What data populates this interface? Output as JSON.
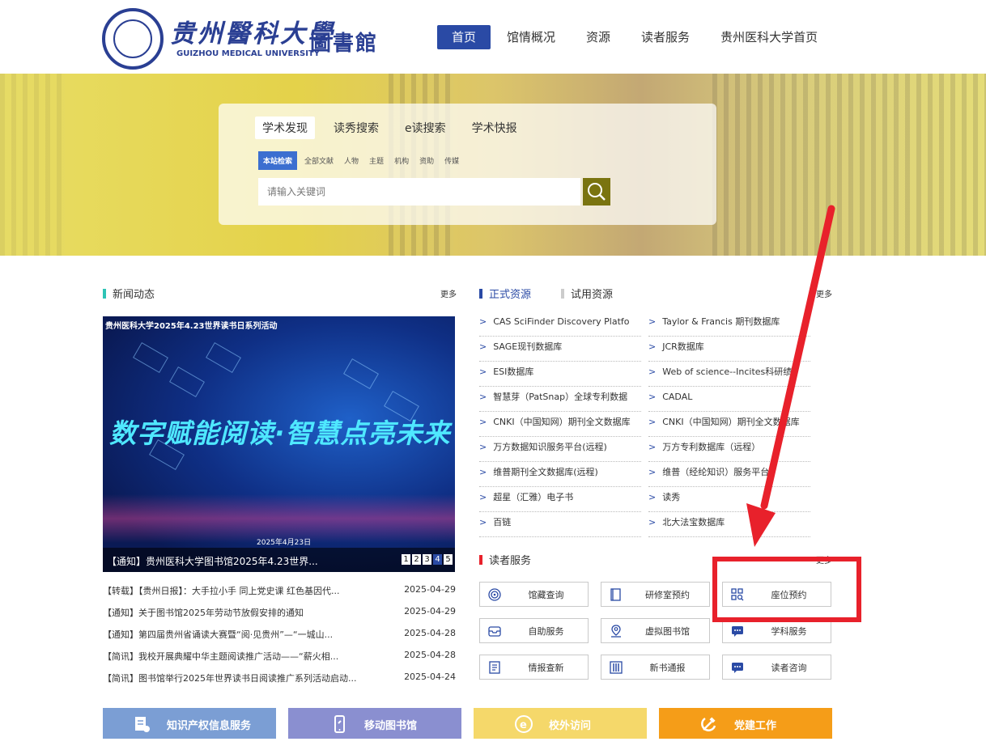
{
  "header": {
    "logo_cn": "贵州醫科大學",
    "logo_en": "GUIZHOU MEDICAL UNIVERSITY",
    "library": "圖書館",
    "nav": [
      "首页",
      "馆情概况",
      "资源",
      "读者服务",
      "贵州医科大学首页"
    ]
  },
  "search": {
    "tabs": [
      "学术发现",
      "读秀搜索",
      "e读搜索",
      "学术快报"
    ],
    "subtabs": [
      "本站检索",
      "全部文献",
      "人物",
      "主题",
      "机构",
      "资助",
      "传媒"
    ],
    "placeholder": "请输入关键词"
  },
  "news": {
    "title": "新闻动态",
    "more": "更多",
    "image_caption_top": "贵州医科大学2025年4.23世界读书日系列活动",
    "image_headline": "数字赋能阅读·智慧点亮未来",
    "image_date": "2025年4月23日",
    "image_caption": "【通知】贵州医科大学图书馆2025年4.23世界...",
    "pager": [
      "1",
      "2",
      "3",
      "4",
      "5"
    ],
    "items": [
      {
        "text": "【转载】【贵州日报】：大手拉小手 同上党史课 红色基因代...",
        "date": "2025-04-29"
      },
      {
        "text": "【通知】关于图书馆2025年劳动节放假安排的通知",
        "date": "2025-04-29"
      },
      {
        "text": "【通知】第四届贵州省诵读大赛暨“阅·见贵州”—“一城山...",
        "date": "2025-04-28"
      },
      {
        "text": "【简讯】我校开展典耀中华主题阅读推广活动——“薪火相...",
        "date": "2025-04-28"
      },
      {
        "text": "【简讯】图书馆举行2025年世界读书日阅读推广系列活动启动...",
        "date": "2025-04-24"
      }
    ]
  },
  "resources": {
    "tab_formal": "正式资源",
    "tab_trial": "试用资源",
    "more": "更多",
    "left": [
      "CAS SciFinder Discovery Platfo",
      "SAGE现刊数据库",
      "ESI数据库",
      "智慧芽（PatSnap）全球专利数据",
      "CNKI（中国知网）期刊全文数据库",
      "万方数据知识服务平台(远程)",
      "维普期刊全文数据库(远程)",
      "超星（汇雅）电子书",
      "百链"
    ],
    "right": [
      "Taylor & Francis 期刊数据库",
      "JCR数据库",
      "Web of science--Incites科研绩",
      "CADAL",
      "CNKI（中国知网）期刊全文数据库",
      "万方专利数据库（远程）",
      "维普（经纶知识）服务平台",
      "读秀",
      "北大法宝数据库"
    ]
  },
  "reader_services": {
    "title": "读者服务",
    "more": "更多",
    "items": [
      {
        "label": "馆藏查询",
        "icon": "fingerprint-icon"
      },
      {
        "label": "研修室预约",
        "icon": "book-icon"
      },
      {
        "label": "座位预约",
        "icon": "seat-search-icon"
      },
      {
        "label": "自助服务",
        "icon": "tray-icon"
      },
      {
        "label": "虚拟图书馆",
        "icon": "map-pin-icon"
      },
      {
        "label": "学科服务",
        "icon": "chat-icon"
      },
      {
        "label": "情报查新",
        "icon": "document-icon"
      },
      {
        "label": "新书通报",
        "icon": "bookshelf-icon"
      },
      {
        "label": "读者咨询",
        "icon": "chat-icon"
      }
    ]
  },
  "bottom_buttons": [
    {
      "label": "知识产权信息服务",
      "color": "#7b9ed4"
    },
    {
      "label": "移动图书馆",
      "color": "#8a8fd0"
    },
    {
      "label": "校外访问",
      "color": "#f5d86a"
    },
    {
      "label": "党建工作",
      "color": "#f59d18"
    }
  ],
  "colors": {
    "brand": "#2a3f93",
    "accent": "#2a4aa5",
    "highlight": "#e8212b"
  }
}
